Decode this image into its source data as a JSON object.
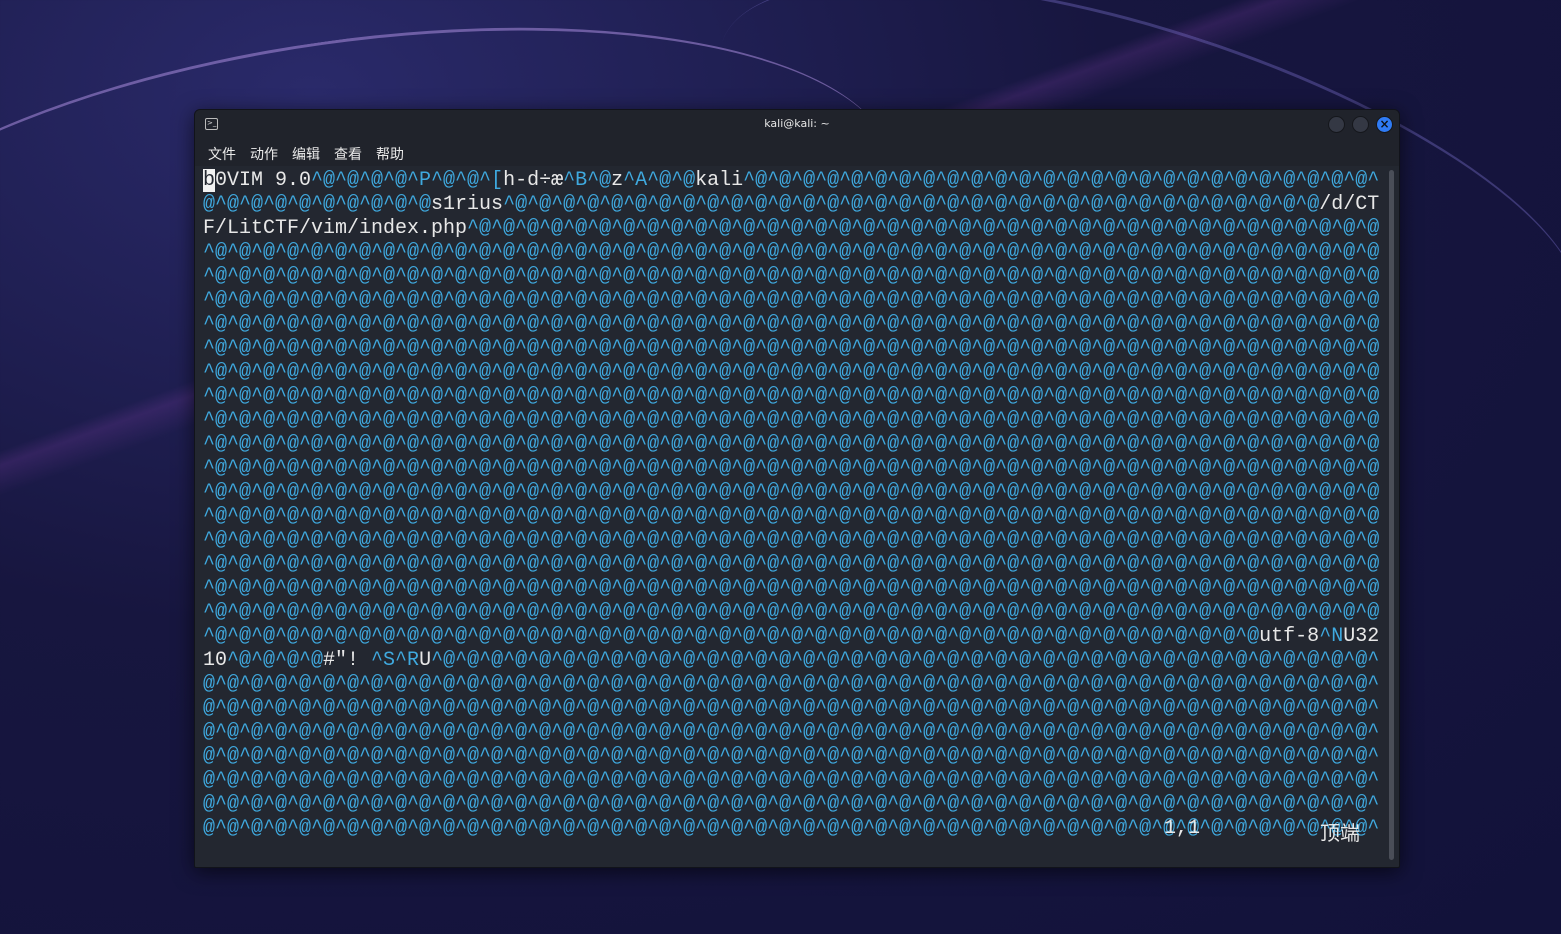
{
  "window": {
    "title": "kali@kali: ~",
    "close_glyph": "×"
  },
  "menu": [
    "文件",
    "动作",
    "编辑",
    "查看",
    "帮助"
  ],
  "terminal": {
    "cursor_char": "b",
    "lines": [
      "0VIM 9.0^@^@^@^@^P^@^@^[h-d÷æ^B^@z^A^@^@kali^@^@^@^@^@^@^@^@^@^@^@^@^@^@^@^@^@^@^@^@^@^@^@^@^@^@^",
      "@^@^@^@^@^@^@^@^@^@s1rius^@^@^@^@^@^@^@^@^@^@^@^@^@^@^@^@^@^@^@^@^@^@^@^@^@^@^@^@^@^@^@^@^@^@/d/CT",
      "F/LitCTF/vim/index.php^@^@^@^@^@^@^@^@^@^@^@^@^@^@^@^@^@^@^@^@^@^@^@^@^@^@^@^@^@^@^@^@^@^@^@^@^@^@",
      "^@^@^@^@^@^@^@^@^@^@^@^@^@^@^@^@^@^@^@^@^@^@^@^@^@^@^@^@^@^@^@^@^@^@^@^@^@^@^@^@^@^@^@^@^@^@^@^@^@",
      "^@^@^@^@^@^@^@^@^@^@^@^@^@^@^@^@^@^@^@^@^@^@^@^@^@^@^@^@^@^@^@^@^@^@^@^@^@^@^@^@^@^@^@^@^@^@^@^@^@",
      "^@^@^@^@^@^@^@^@^@^@^@^@^@^@^@^@^@^@^@^@^@^@^@^@^@^@^@^@^@^@^@^@^@^@^@^@^@^@^@^@^@^@^@^@^@^@^@^@^@",
      "^@^@^@^@^@^@^@^@^@^@^@^@^@^@^@^@^@^@^@^@^@^@^@^@^@^@^@^@^@^@^@^@^@^@^@^@^@^@^@^@^@^@^@^@^@^@^@^@^@",
      "^@^@^@^@^@^@^@^@^@^@^@^@^@^@^@^@^@^@^@^@^@^@^@^@^@^@^@^@^@^@^@^@^@^@^@^@^@^@^@^@^@^@^@^@^@^@^@^@^@",
      "^@^@^@^@^@^@^@^@^@^@^@^@^@^@^@^@^@^@^@^@^@^@^@^@^@^@^@^@^@^@^@^@^@^@^@^@^@^@^@^@^@^@^@^@^@^@^@^@^@",
      "^@^@^@^@^@^@^@^@^@^@^@^@^@^@^@^@^@^@^@^@^@^@^@^@^@^@^@^@^@^@^@^@^@^@^@^@^@^@^@^@^@^@^@^@^@^@^@^@^@",
      "^@^@^@^@^@^@^@^@^@^@^@^@^@^@^@^@^@^@^@^@^@^@^@^@^@^@^@^@^@^@^@^@^@^@^@^@^@^@^@^@^@^@^@^@^@^@^@^@^@",
      "^@^@^@^@^@^@^@^@^@^@^@^@^@^@^@^@^@^@^@^@^@^@^@^@^@^@^@^@^@^@^@^@^@^@^@^@^@^@^@^@^@^@^@^@^@^@^@^@^@",
      "^@^@^@^@^@^@^@^@^@^@^@^@^@^@^@^@^@^@^@^@^@^@^@^@^@^@^@^@^@^@^@^@^@^@^@^@^@^@^@^@^@^@^@^@^@^@^@^@^@",
      "^@^@^@^@^@^@^@^@^@^@^@^@^@^@^@^@^@^@^@^@^@^@^@^@^@^@^@^@^@^@^@^@^@^@^@^@^@^@^@^@^@^@^@^@^@^@^@^@^@",
      "^@^@^@^@^@^@^@^@^@^@^@^@^@^@^@^@^@^@^@^@^@^@^@^@^@^@^@^@^@^@^@^@^@^@^@^@^@^@^@^@^@^@^@^@^@^@^@^@^@",
      "^@^@^@^@^@^@^@^@^@^@^@^@^@^@^@^@^@^@^@^@^@^@^@^@^@^@^@^@^@^@^@^@^@^@^@^@^@^@^@^@^@^@^@^@^@^@^@^@^@",
      "^@^@^@^@^@^@^@^@^@^@^@^@^@^@^@^@^@^@^@^@^@^@^@^@^@^@^@^@^@^@^@^@^@^@^@^@^@^@^@^@^@^@^@^@^@^@^@^@^@",
      "^@^@^@^@^@^@^@^@^@^@^@^@^@^@^@^@^@^@^@^@^@^@^@^@^@^@^@^@^@^@^@^@^@^@^@^@^@^@^@^@^@^@^@^@^@^@^@^@^@",
      "^@^@^@^@^@^@^@^@^@^@^@^@^@^@^@^@^@^@^@^@^@^@^@^@^@^@^@^@^@^@^@^@^@^@^@^@^@^@^@^@^@^@^@^@^@^@^@^@^@",
      "^@^@^@^@^@^@^@^@^@^@^@^@^@^@^@^@^@^@^@^@^@^@^@^@^@^@^@^@^@^@^@^@^@^@^@^@^@^@^@^@^@^@^@^@utf-8^NU32",
      "10^@^@^@^@#\"! ^S^RU^@^@^@^@^@^@^@^@^@^@^@^@^@^@^@^@^@^@^@^@^@^@^@^@^@^@^@^@^@^@^@^@^@^@^@^@^@^@^@^",
      "@^@^@^@^@^@^@^@^@^@^@^@^@^@^@^@^@^@^@^@^@^@^@^@^@^@^@^@^@^@^@^@^@^@^@^@^@^@^@^@^@^@^@^@^@^@^@^@^@^",
      "@^@^@^@^@^@^@^@^@^@^@^@^@^@^@^@^@^@^@^@^@^@^@^@^@^@^@^@^@^@^@^@^@^@^@^@^@^@^@^@^@^@^@^@^@^@^@^@^@^",
      "@^@^@^@^@^@^@^@^@^@^@^@^@^@^@^@^@^@^@^@^@^@^@^@^@^@^@^@^@^@^@^@^@^@^@^@^@^@^@^@^@^@^@^@^@^@^@^@^@^",
      "@^@^@^@^@^@^@^@^@^@^@^@^@^@^@^@^@^@^@^@^@^@^@^@^@^@^@^@^@^@^@^@^@^@^@^@^@^@^@^@^@^@^@^@^@^@^@^@^@^",
      "@^@^@^@^@^@^@^@^@^@^@^@^@^@^@^@^@^@^@^@^@^@^@^@^@^@^@^@^@^@^@^@^@^@^@^@^@^@^@^@^@^@^@^@^@^@^@^@^@^",
      "@^@^@^@^@^@^@^@^@^@^@^@^@^@^@^@^@^@^@^@^@^@^@^@^@^@^@^@^@^@^@^@^@^@^@^@^@^@^@^@^@^@^@^@^@^@^@^@^@^",
      "@^@^@^@^@^@^@^@^@^@^@^@^@^@^@^@^@^@^@^@^@^@^@^@^@^@^@^@^@^@^@^@^@^@^@^@^@^@^@^@^@^@^@^@^@^@^@^@^@^"
    ],
    "position": "1,1",
    "scroll_position": "顶端",
    "control_color": "#3fa9df",
    "text_color": "#e8e8e8"
  }
}
